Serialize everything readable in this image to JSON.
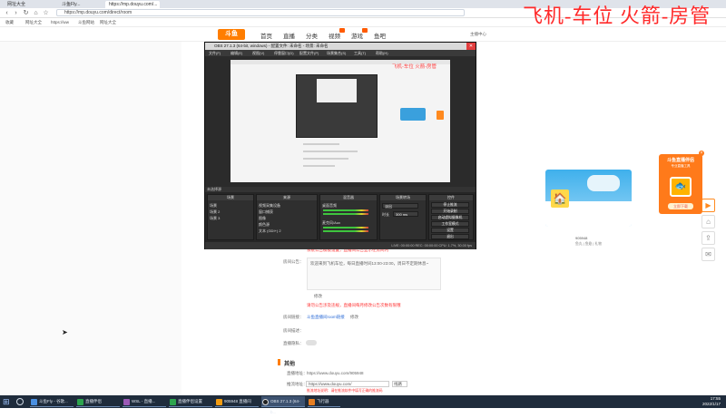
{
  "browser": {
    "tabs": [
      {
        "label": "网址大全"
      },
      {
        "label": "斗鱼Fly..."
      },
      {
        "label": "https://mp.douyu.com/..."
      }
    ],
    "url": "https://mp.douyu.com/direct/room",
    "bookmarks": [
      "收藏",
      "网址大全",
      "https://ww",
      "斗鱼网站",
      "网址大全"
    ]
  },
  "overlay_text": "飞机-车位 火箭-房管",
  "site": {
    "logo": "斗鱼",
    "nav": [
      "首页",
      "直播",
      "分类",
      "视频",
      "游戏",
      "鱼吧"
    ],
    "user_area": "主播中心"
  },
  "settings": {
    "notice_red": "系统公告模板设置，直播间公告显示在房间内",
    "notice_label": "房间公告：",
    "notice_text": "欢迎来到飞机车位，每日直播时间13:00-23:00，周日不定期休息~",
    "edit_label": "修改",
    "edit_tip": "请勿公告涉及违规，直播间每月修改公告次数有限哦",
    "link_label": "房间链接：",
    "link_value": "斗鱼直播间room链接",
    "link_action": "修改",
    "desc_label": "房间描述：",
    "privacy_label": "直播隐私：",
    "section_title": "其他",
    "room_url_label": "直播地址：",
    "room_url": "https://www.douyu.com/905948",
    "stream_label": "推流地址：",
    "stream_input": "https://www.douyu.com/",
    "stream_select": "线路",
    "stream_tip": "推流地址说明：请在推流软件中填写正确的推流码"
  },
  "obs": {
    "title": "OBS 27.1.3 (64-bit, windows) - 配置文件: 未命名 - 场景: 未命名",
    "menu": [
      "文件(F)",
      "编辑(E)",
      "视图(V)",
      "停靠窗口(D)",
      "配置文件(P)",
      "场景集合(S)",
      "工具(T)",
      "帮助(H)"
    ],
    "preview_text": "飞机-车位 火箭-房管",
    "status_label": "未选择源",
    "docks": {
      "scenes": {
        "title": "场景",
        "items": [
          "场景",
          "场景 2",
          "场景 3"
        ]
      },
      "sources": {
        "title": "来源",
        "items": [
          "视频采集设备",
          "窗口捕获",
          "图像",
          "颜色源",
          "文本 (GDI+) 2"
        ]
      },
      "mixer": {
        "title": "混音器",
        "items": [
          "桌面音频",
          "麦克风/Aux"
        ]
      },
      "transitions": {
        "title": "场景转场",
        "type": "淡出",
        "duration_label": "时长",
        "duration": "300 ms"
      },
      "controls": {
        "title": "控件",
        "buttons": [
          "停止推流",
          "开始录制",
          "启动虚拟摄像机",
          "工作室模式",
          "设置",
          "退出"
        ]
      }
    },
    "footer": "LIVE: 00:00:00  REC: 00:00:00  CPU: 1.7%, 30.00 fps"
  },
  "widgets": {
    "gift_caption": "905948",
    "gift_sub": "鱼丸 | 鱼翅 | 礼物",
    "promo_title": "斗鱼直播伴侣",
    "promo_sub": "专业直播工具",
    "promo_button": "立即下载",
    "side_icons": [
      "play-icon",
      "home-icon",
      "share-icon",
      "message-icon"
    ]
  },
  "taskbar": {
    "items": [
      {
        "label": "斗鱼Fly - 谷歌..."
      },
      {
        "label": "直播伴侣"
      },
      {
        "label": "WSL - 直播..."
      },
      {
        "label": "直播伴侣设置"
      },
      {
        "label": "905948 直播间"
      },
      {
        "label": "OBS 27.1.3 (64-b..."
      },
      {
        "label": "飞行器"
      }
    ],
    "time": "17:55",
    "date": "2022/1/17"
  },
  "colors": {
    "accent": "#ff7d00",
    "overlay": "#ff2a2a",
    "obs_bg": "#2b2b2b",
    "taskbar": "#1f2c3c"
  }
}
